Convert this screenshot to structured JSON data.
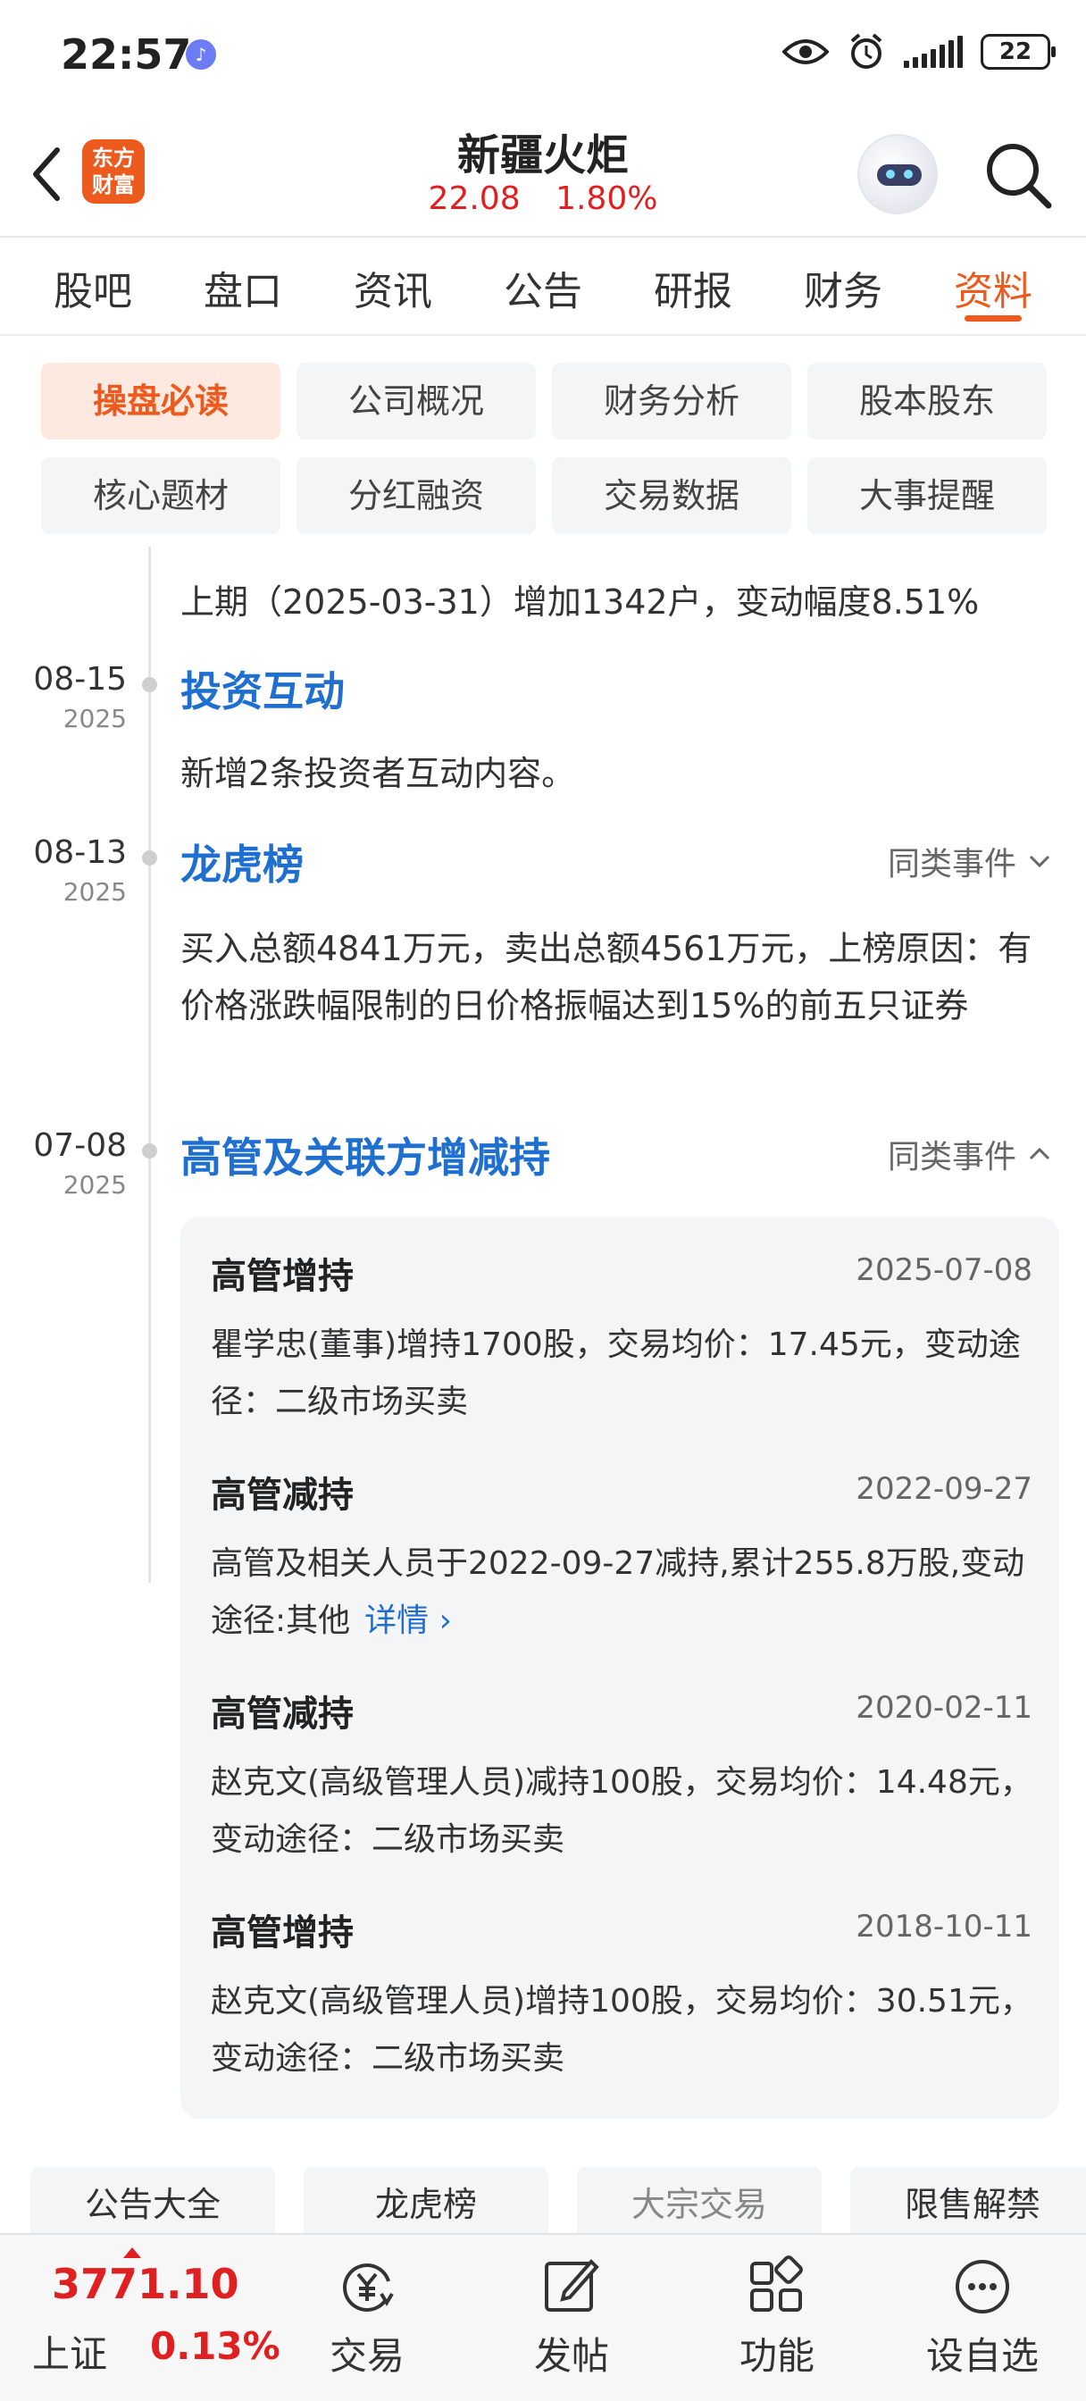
{
  "status_bar": {
    "time": "22:57",
    "battery": "22"
  },
  "header": {
    "logo_text": "东方财富",
    "stock_name": "新疆火炬",
    "price": "22.08",
    "change_pct": "1.80%"
  },
  "main_tabs": [
    "股吧",
    "盘口",
    "资讯",
    "公告",
    "研报",
    "财务",
    "资料"
  ],
  "main_tab_active": "资料",
  "sub_tabs": [
    "操盘必读",
    "公司概况",
    "财务分析",
    "股本股东",
    "核心题材",
    "分红融资",
    "交易数据",
    "大事提醒"
  ],
  "timeline": {
    "prev_text": "上期（2025-03-31）增加1342户，变动幅度8.51%",
    "events": [
      {
        "date_md": "08-15",
        "date_y": "2025",
        "title": "投资互动",
        "body": "新增2条投资者互动内容。"
      },
      {
        "date_md": "08-13",
        "date_y": "2025",
        "title": "龙虎榜",
        "similar": "同类事件",
        "body": "买入总额4841万元，卖出总额4561万元，上榜原因：有价格涨跌幅限制的日价格振幅达到15%的前五只证券"
      },
      {
        "date_md": "07-08",
        "date_y": "2025",
        "title": "高管及关联方增减持",
        "similar": "同类事件"
      }
    ],
    "details": [
      {
        "title": "高管增持",
        "date": "2025-07-08",
        "body": "瞿学忠(董事)增持1700股，交易均价：17.45元，变动途径：二级市场买卖"
      },
      {
        "title": "高管减持",
        "date": "2022-09-27",
        "body": "高管及相关人员于2022-09-27减持,累计255.8万股,变动途径:其他",
        "link": "详情"
      },
      {
        "title": "高管减持",
        "date": "2020-02-11",
        "body": "赵克文(高级管理人员)减持100股，交易均价：14.48元，变动途径：二级市场买卖"
      },
      {
        "title": "高管增持",
        "date": "2018-10-11",
        "body": "赵克文(高级管理人员)增持100股，交易均价：30.51元，变动途径：二级市场买卖"
      }
    ]
  },
  "shortcuts": [
    "公告大全",
    "龙虎榜",
    "大宗交易",
    "限售解禁"
  ],
  "bottom_bar": {
    "index_value": "3771.10",
    "index_name": "上证",
    "index_change": "0.13%",
    "nav": [
      {
        "label": "交易",
        "icon": "trade-yuan-icon"
      },
      {
        "label": "发帖",
        "icon": "edit-post-icon"
      },
      {
        "label": "功能",
        "icon": "apps-grid-icon"
      },
      {
        "label": "设自选",
        "icon": "more-dots-icon"
      }
    ]
  },
  "colors": {
    "accent": "#ec5a1e",
    "link_blue": "#1f6fd1",
    "up_red": "#e02020"
  }
}
